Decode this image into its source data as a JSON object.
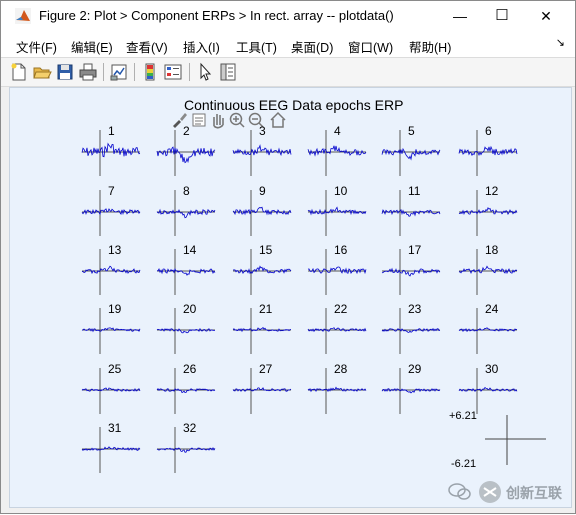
{
  "window": {
    "title": "Figure 2: Plot > Component ERPs > In rect. array -- plotdata()",
    "minimize_glyph": "—",
    "maximize_glyph": "☐",
    "close_glyph": "✕"
  },
  "menu": {
    "items": [
      "文件(F)",
      "编辑(E)",
      "查看(V)",
      "插入(I)",
      "工具(T)",
      "桌面(D)",
      "窗口(W)",
      "帮助(H)"
    ],
    "corner_glyph": "↘"
  },
  "toolbar": {
    "buttons": [
      "new-figure-icon",
      "open-icon",
      "save-icon",
      "print-icon",
      "link-plot-icon",
      "colorbar-icon",
      "legend-icon",
      "pointer-icon",
      "property-editor-icon"
    ]
  },
  "figure": {
    "title": "Continuous EEG Data epochs ERP",
    "axes_tools": [
      "brush-icon",
      "datatip-icon",
      "pan-icon",
      "zoom-in-icon",
      "zoom-out-icon",
      "home-icon"
    ],
    "panel_labels": [
      "1",
      "2",
      "3",
      "4",
      "5",
      "6",
      "7",
      "8",
      "9",
      "10",
      "11",
      "12",
      "13",
      "14",
      "15",
      "16",
      "17",
      "18",
      "19",
      "20",
      "21",
      "22",
      "23",
      "24",
      "25",
      "26",
      "27",
      "28",
      "29",
      "30",
      "31",
      "32"
    ],
    "scale": {
      "max": "+6.21",
      "min": "-6.21"
    },
    "trace_color": "#0000cc"
  },
  "watermark": {
    "text": "创新互联"
  }
}
